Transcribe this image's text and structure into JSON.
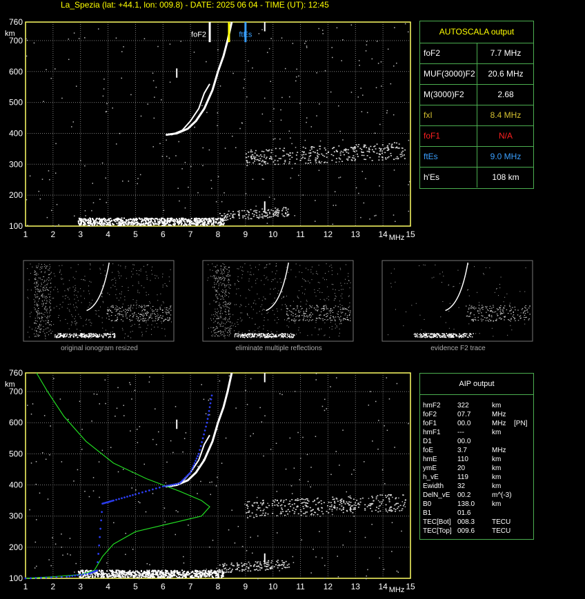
{
  "title": "La_Spezia (lat: +44.1, lon: 009.8) - DATE: 2025 06 04 - TIME (UT): 12:45",
  "colors": {
    "grid": "#808080",
    "axis": "#ffff66",
    "green": "#4caf50",
    "trace": "#ffffff",
    "profile": "#22dd22",
    "blue": "#2b3df0",
    "yellow": "#ffff00",
    "red": "#ff2020",
    "cyan": "#3aa0ff"
  },
  "autoscala": {
    "header": "AUTOSCALA output",
    "rows": [
      {
        "key": "foF2",
        "value": "7.7 MHz",
        "color": "#ffffff"
      },
      {
        "key": "MUF(3000)F2",
        "value": "20.6 MHz",
        "color": "#ffffff"
      },
      {
        "key": "M(3000)F2",
        "value": "2.68",
        "color": "#ffffff"
      },
      {
        "key": "fxI",
        "value": "8.4 MHz",
        "color": "#d4c030"
      },
      {
        "key": "foF1",
        "value": "N/A",
        "color": "#ff2020"
      },
      {
        "key": "ftEs",
        "value": "9.0 MHz",
        "color": "#3aa0ff"
      },
      {
        "key": "h'Es",
        "value": "108     km",
        "color": "#ffffff"
      }
    ]
  },
  "aip": {
    "header": "AIP output",
    "rows": [
      {
        "k": "hmF2",
        "v": "322",
        "u": "km",
        "x": ""
      },
      {
        "k": "foF2",
        "v": "07.7",
        "u": "MHz",
        "x": ""
      },
      {
        "k": "foF1",
        "v": "00.0",
        "u": "MHz",
        "x": "[PN]"
      },
      {
        "k": "hmF1",
        "v": "---",
        "u": "km",
        "x": ""
      },
      {
        "k": "D1",
        "v": "00.0",
        "u": "",
        "x": ""
      },
      {
        "k": "foE",
        "v": "3.7",
        "u": "MHz",
        "x": ""
      },
      {
        "k": "hmE",
        "v": "110",
        "u": "km",
        "x": ""
      },
      {
        "k": "ymE",
        "v": "20",
        "u": "km",
        "x": ""
      },
      {
        "k": "h_vE",
        "v": "119",
        "u": "km",
        "x": ""
      },
      {
        "k": "Ewidth",
        "v": "32",
        "u": "km",
        "x": ""
      },
      {
        "k": "DelN_vE",
        "v": "00.2",
        "u": "m^(-3)",
        "x": ""
      },
      {
        "k": "B0",
        "v": "138.0",
        "u": "km",
        "x": ""
      },
      {
        "k": "B1",
        "v": "01.6",
        "u": "",
        "x": ""
      },
      {
        "k": "TEC[Bot]",
        "v": "008.3",
        "u": "TECU",
        "x": ""
      },
      {
        "k": "TEC[Top]",
        "v": "009.6",
        "u": "TECU",
        "x": ""
      }
    ]
  },
  "captions": [
    "original ionogram resized",
    "eliminate multiple reflections",
    "evidence F2 trace"
  ],
  "chart_data": [
    {
      "type": "scatter",
      "name_panel": "top ionogram",
      "xlabel": "MHz",
      "ylabel": "km",
      "xlim": [
        1,
        15
      ],
      "ylim": [
        100,
        760
      ],
      "x_ticks": [
        1,
        2,
        3,
        4,
        5,
        6,
        7,
        8,
        9,
        10,
        11,
        12,
        13,
        14,
        15
      ],
      "y_ticks": [
        100,
        200,
        300,
        400,
        500,
        600,
        700,
        760
      ],
      "grid": true,
      "markers": [
        {
          "label": "foF2",
          "x": 7.7,
          "color": "#ffffff"
        },
        {
          "label": "",
          "x": 8.4,
          "color": "#ffff00"
        },
        {
          "label": "ftEs",
          "x": 9.0,
          "color": "#3aa0ff"
        }
      ],
      "f2_trace": [
        [
          6.1,
          395
        ],
        [
          6.5,
          400
        ],
        [
          6.9,
          415
        ],
        [
          7.2,
          440
        ],
        [
          7.5,
          480
        ],
        [
          7.8,
          540
        ],
        [
          8.0,
          600
        ],
        [
          8.2,
          650
        ],
        [
          8.35,
          700
        ],
        [
          8.5,
          760
        ]
      ],
      "f2_trace_x": [
        [
          6.3,
          395
        ],
        [
          6.7,
          410
        ],
        [
          7.0,
          440
        ],
        [
          7.3,
          480
        ],
        [
          7.5,
          530
        ],
        [
          7.7,
          560
        ]
      ],
      "e_layer": [
        [
          2.9,
          105
        ],
        [
          3.3,
          112
        ],
        [
          5,
          118
        ],
        [
          7,
          120
        ],
        [
          8,
          125
        ],
        [
          9.5,
          130
        ],
        [
          10.5,
          150
        ]
      ],
      "es_layer": [
        [
          9.0,
          310
        ],
        [
          10,
          320
        ],
        [
          11,
          325
        ],
        [
          12,
          330
        ],
        [
          13,
          330
        ],
        [
          14,
          335
        ],
        [
          14.8,
          340
        ]
      ]
    },
    {
      "type": "line",
      "name_panel": "bottom ionogram with profile",
      "xlabel": "MHz",
      "ylabel": "km",
      "xlim": [
        1,
        15
      ],
      "ylim": [
        100,
        760
      ],
      "x_ticks": [
        1,
        2,
        3,
        4,
        5,
        6,
        7,
        8,
        9,
        10,
        11,
        12,
        13,
        14,
        15
      ],
      "y_ticks": [
        100,
        200,
        300,
        400,
        500,
        600,
        700,
        760
      ],
      "grid": true,
      "profile": [
        [
          1.4,
          760
        ],
        [
          1.8,
          700
        ],
        [
          2.4,
          620
        ],
        [
          3.2,
          540
        ],
        [
          4.2,
          470
        ],
        [
          5.4,
          420
        ],
        [
          6.6,
          380
        ],
        [
          7.4,
          350
        ],
        [
          7.7,
          330
        ],
        [
          7.4,
          300
        ],
        [
          6.2,
          275
        ],
        [
          5.0,
          250
        ],
        [
          4.2,
          210
        ],
        [
          3.8,
          170
        ],
        [
          3.6,
          140
        ],
        [
          3.5,
          125
        ],
        [
          3.0,
          112
        ],
        [
          2.0,
          105
        ],
        [
          1.0,
          100
        ]
      ],
      "blue_profile": [
        [
          1.0,
          100
        ],
        [
          2.5,
          105
        ],
        [
          3.3,
          115
        ],
        [
          3.6,
          125
        ],
        [
          3.8,
          340
        ],
        [
          4.2,
          350
        ],
        [
          5.0,
          370
        ],
        [
          6.0,
          395
        ],
        [
          6.6,
          405
        ],
        [
          7.0,
          440
        ],
        [
          7.3,
          500
        ],
        [
          7.6,
          600
        ],
        [
          7.8,
          700
        ]
      ],
      "f2_trace": [
        [
          6.1,
          395
        ],
        [
          6.5,
          400
        ],
        [
          6.9,
          415
        ],
        [
          7.2,
          440
        ],
        [
          7.5,
          480
        ],
        [
          7.8,
          540
        ],
        [
          8.0,
          600
        ],
        [
          8.2,
          650
        ],
        [
          8.35,
          700
        ],
        [
          8.5,
          760
        ]
      ],
      "f2_trace_x": [
        [
          6.3,
          395
        ],
        [
          6.7,
          410
        ],
        [
          7.0,
          440
        ],
        [
          7.3,
          480
        ],
        [
          7.5,
          530
        ],
        [
          7.7,
          560
        ]
      ],
      "e_layer": [
        [
          2.9,
          105
        ],
        [
          3.3,
          112
        ],
        [
          5,
          118
        ],
        [
          7,
          120
        ],
        [
          8,
          125
        ],
        [
          9.5,
          130
        ],
        [
          10.5,
          150
        ]
      ],
      "es_layer": [
        [
          9.0,
          310
        ],
        [
          10,
          320
        ],
        [
          11,
          325
        ],
        [
          12,
          330
        ],
        [
          13,
          330
        ],
        [
          14,
          335
        ],
        [
          14.8,
          340
        ]
      ]
    }
  ]
}
